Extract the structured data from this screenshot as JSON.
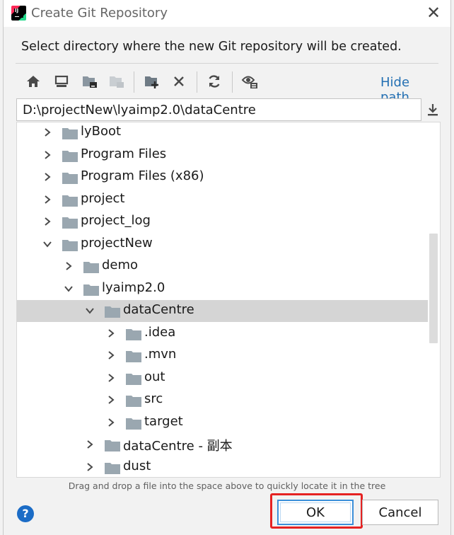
{
  "dialog": {
    "title": "Create Git Repository",
    "description": "Select directory where the new Git repository will be created.",
    "hint": "Drag and drop a file into the space above to quickly locate it in the tree",
    "ok_label": "OK",
    "cancel_label": "Cancel",
    "help_label": "?",
    "close_label": "✕"
  },
  "toolbar": {
    "hide_path_label": "Hide path",
    "buttons": [
      "home-icon",
      "desktop-icon",
      "project-folder-icon",
      "module-folder-icon",
      "new-folder-icon",
      "delete-icon",
      "refresh-icon",
      "show-hidden-icon"
    ]
  },
  "path": {
    "value": "D:\\projectNew\\lyaimp2.0\\dataCentre"
  },
  "tree": {
    "items": [
      {
        "label": "lyBoot",
        "depth": 0,
        "expanded": false,
        "selected": false
      },
      {
        "label": "Program Files",
        "depth": 0,
        "expanded": false,
        "selected": false
      },
      {
        "label": "Program Files (x86)",
        "depth": 0,
        "expanded": false,
        "selected": false
      },
      {
        "label": "project",
        "depth": 0,
        "expanded": false,
        "selected": false
      },
      {
        "label": "project_log",
        "depth": 0,
        "expanded": false,
        "selected": false
      },
      {
        "label": "projectNew",
        "depth": 0,
        "expanded": true,
        "selected": false
      },
      {
        "label": "demo",
        "depth": 1,
        "expanded": false,
        "selected": false
      },
      {
        "label": "lyaimp2.0",
        "depth": 1,
        "expanded": true,
        "selected": false
      },
      {
        "label": "dataCentre",
        "depth": 2,
        "expanded": true,
        "selected": true
      },
      {
        "label": ".idea",
        "depth": 3,
        "expanded": false,
        "selected": false
      },
      {
        "label": ".mvn",
        "depth": 3,
        "expanded": false,
        "selected": false
      },
      {
        "label": "out",
        "depth": 3,
        "expanded": false,
        "selected": false
      },
      {
        "label": "src",
        "depth": 3,
        "expanded": false,
        "selected": false
      },
      {
        "label": "target",
        "depth": 3,
        "expanded": false,
        "selected": false
      },
      {
        "label": "dataCentre - 副本",
        "depth": 2,
        "expanded": false,
        "selected": false
      },
      {
        "label": "dust",
        "depth": 2,
        "expanded": false,
        "selected": false
      }
    ]
  },
  "colors": {
    "accent": "#2470b3",
    "selection": "#d5d5d5",
    "folder": "#9aa7b0",
    "highlight_box": "#e52222"
  }
}
